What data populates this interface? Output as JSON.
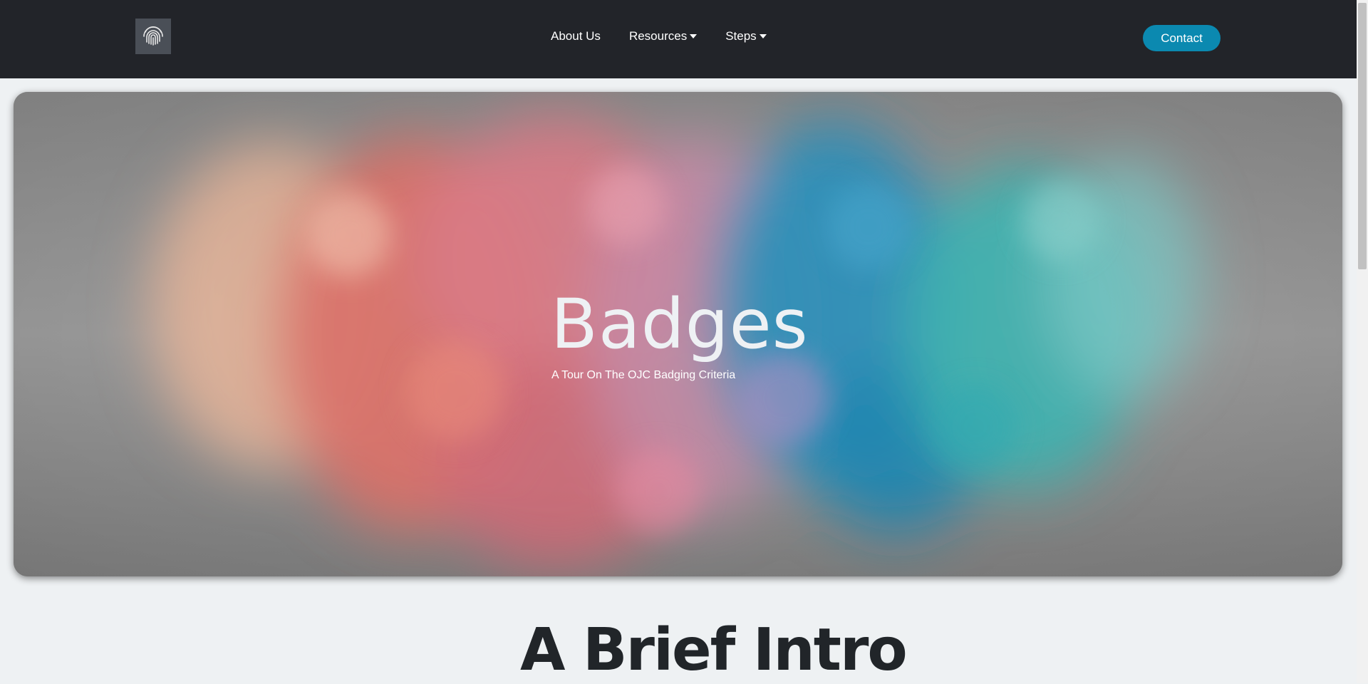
{
  "nav": {
    "logo_icon": "fingerprint-icon",
    "links": [
      {
        "label": "About Us",
        "has_dropdown": false
      },
      {
        "label": "Resources",
        "has_dropdown": true
      },
      {
        "label": "Steps",
        "has_dropdown": true
      }
    ],
    "contact_label": "Contact"
  },
  "hero": {
    "title": "Badges",
    "subtitle": "A Tour On The OJC Badging Criteria",
    "background": "colorful-ink-smoke-image"
  },
  "intro": {
    "heading": "A Brief Intro"
  },
  "colors": {
    "navbar": "#222429",
    "accent": "#0b89b0",
    "page_bg": "#eef1f3"
  }
}
